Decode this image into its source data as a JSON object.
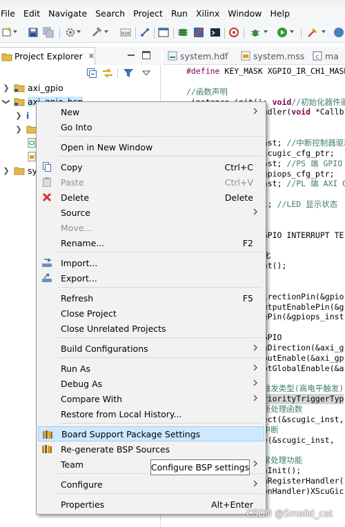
{
  "menubar": {
    "items": [
      "File",
      "Edit",
      "Navigate",
      "Search",
      "Project",
      "Run",
      "Xilinx",
      "Window",
      "Help"
    ]
  },
  "project_explorer": {
    "title": "Project Explorer",
    "close_glyph": "✕",
    "tree": [
      {
        "expanded": false,
        "label": "axi_gpio"
      },
      {
        "expanded": true,
        "label": "axi_gpio_bsp"
      },
      {
        "expanded": false,
        "label": "i"
      },
      {
        "expanded": false,
        "label": ""
      },
      {
        "expanded": false,
        "label": ""
      },
      {
        "expanded": false,
        "label": ""
      },
      {
        "expanded": false,
        "label": "sy"
      }
    ]
  },
  "editor": {
    "tabs": [
      "system.hdf",
      "system.mss",
      "ma"
    ],
    "lines": [
      {
        "pre": "#define",
        "rest": " KEY_MASK XGPIO_IR_CH1_MASK"
      },
      {
        "rest": ""
      },
      {
        "cm": "//函数声明"
      },
      {
        "kw": "void",
        "rest": " instance_init(); ",
        "cm": "//初始化器件驱动"
      },
      {
        "rest": "                ndler(",
        "kw": "void",
        "rest2": " *Callb"
      },
      {
        "rest": ""
      },
      {
        "rest": ""
      },
      {
        "rest": "                nst; ",
        "cm": "//中断控制器驱动程序"
      },
      {
        "rest": "                scugic_cfg_ptr;"
      },
      {
        "rest": "                nst; ",
        "cm": "//PS 端 GPIO 驱"
      },
      {
        "rest": "                gpiops_cfg_ptr;"
      },
      {
        "rest": "                nst; ",
        "cm": "//PL 端 AXI GPI"
      },
      {
        "rest": ""
      },
      {
        "rest": "                l; ",
        "cm": "//LED 显示状态"
      },
      {
        "rest": ""
      },
      {
        "rest": ""
      },
      {
        "rest": "                GPIO INTERRUPT TE"
      },
      {
        "rest": ""
      },
      {
        "rest": "                化"
      },
      {
        "rest": "                nt();"
      },
      {
        "rest": ""
      },
      {
        "rest": ""
      },
      {
        "rest": "                irectionPin(&gpio"
      },
      {
        "rest": "                utputEnablePin(&g"
      },
      {
        "rest": "                ePin(&gpiops_inst"
      },
      {
        "rest": ""
      },
      {
        "rest": "                GPIO"
      },
      {
        "rest": "                aDirection(&axi_g"
      },
      {
        "rest": "                putEnable(&axi_gp"
      },
      {
        "rest": "                ptGlobalEnable(&a"
      },
      {
        "rest": ""
      },
      {
        "cm": "                触发类型(高电平触发)"
      },
      {
        "rest": "                riorityTriggerTyp",
        "selected": true
      },
      {
        "cm": "                断处理函数"
      },
      {
        "rest": "                ect(&scugic_inst,"
      },
      {
        "cm": "                中断"
      },
      {
        "rest": "                e(&scugic_inst,"
      },
      {
        "rest": ""
      },
      {
        "cm": "                常处理功能"
      },
      {
        "rest": "                nInit();"
      },
      {
        "rest": "                nRegisterHandler("
      },
      {
        "rest": "                onHandler)XScuGic"
      }
    ]
  },
  "context_menu": {
    "items": [
      {
        "label": "New",
        "submenu": true
      },
      {
        "label": "Go Into"
      },
      {
        "sep": true
      },
      {
        "label": "Open in New Window"
      },
      {
        "sep": true
      },
      {
        "label": "Copy",
        "shortcut": "Ctrl+C",
        "icon": "copy-icon"
      },
      {
        "label": "Paste",
        "shortcut": "Ctrl+V",
        "icon": "paste-icon",
        "disabled": true
      },
      {
        "label": "Delete",
        "shortcut": "Delete",
        "icon": "delete-icon"
      },
      {
        "label": "Source",
        "submenu": true
      },
      {
        "label": "Move...",
        "disabled": true
      },
      {
        "label": "Rename...",
        "shortcut": "F2"
      },
      {
        "sep": true
      },
      {
        "label": "Import...",
        "icon": "import-icon"
      },
      {
        "label": "Export...",
        "icon": "export-icon"
      },
      {
        "sep": true
      },
      {
        "label": "Refresh",
        "shortcut": "F5"
      },
      {
        "label": "Close Project"
      },
      {
        "label": "Close Unrelated Projects"
      },
      {
        "sep": true
      },
      {
        "label": "Build Configurations",
        "submenu": true
      },
      {
        "sep": true
      },
      {
        "label": "Run As",
        "submenu": true
      },
      {
        "label": "Debug As",
        "submenu": true
      },
      {
        "label": "Compare With",
        "submenu": true
      },
      {
        "label": "Restore from Local History..."
      },
      {
        "sep": true
      },
      {
        "label": "Board Support Package Settings",
        "icon": "bsp-icon",
        "highlighted": true
      },
      {
        "label": "Re-generate BSP Sources",
        "icon": "bsp-icon"
      },
      {
        "label": "Team",
        "submenu": true
      },
      {
        "sep": true
      },
      {
        "label": "Configure",
        "submenu": true
      },
      {
        "sep": true
      },
      {
        "label": "Properties",
        "shortcut": "Alt+Enter"
      }
    ]
  },
  "tooltip": {
    "text": "Configure BSP settings"
  },
  "watermark": {
    "text": "CSDN @Smalld_cat"
  },
  "colors": {
    "highlight_bg": "#cde8ff",
    "highlight_border": "#99d1ff",
    "menu_bg": "#f2f2f2",
    "folder": "#e8b84a",
    "delete_red": "#d9322f"
  }
}
